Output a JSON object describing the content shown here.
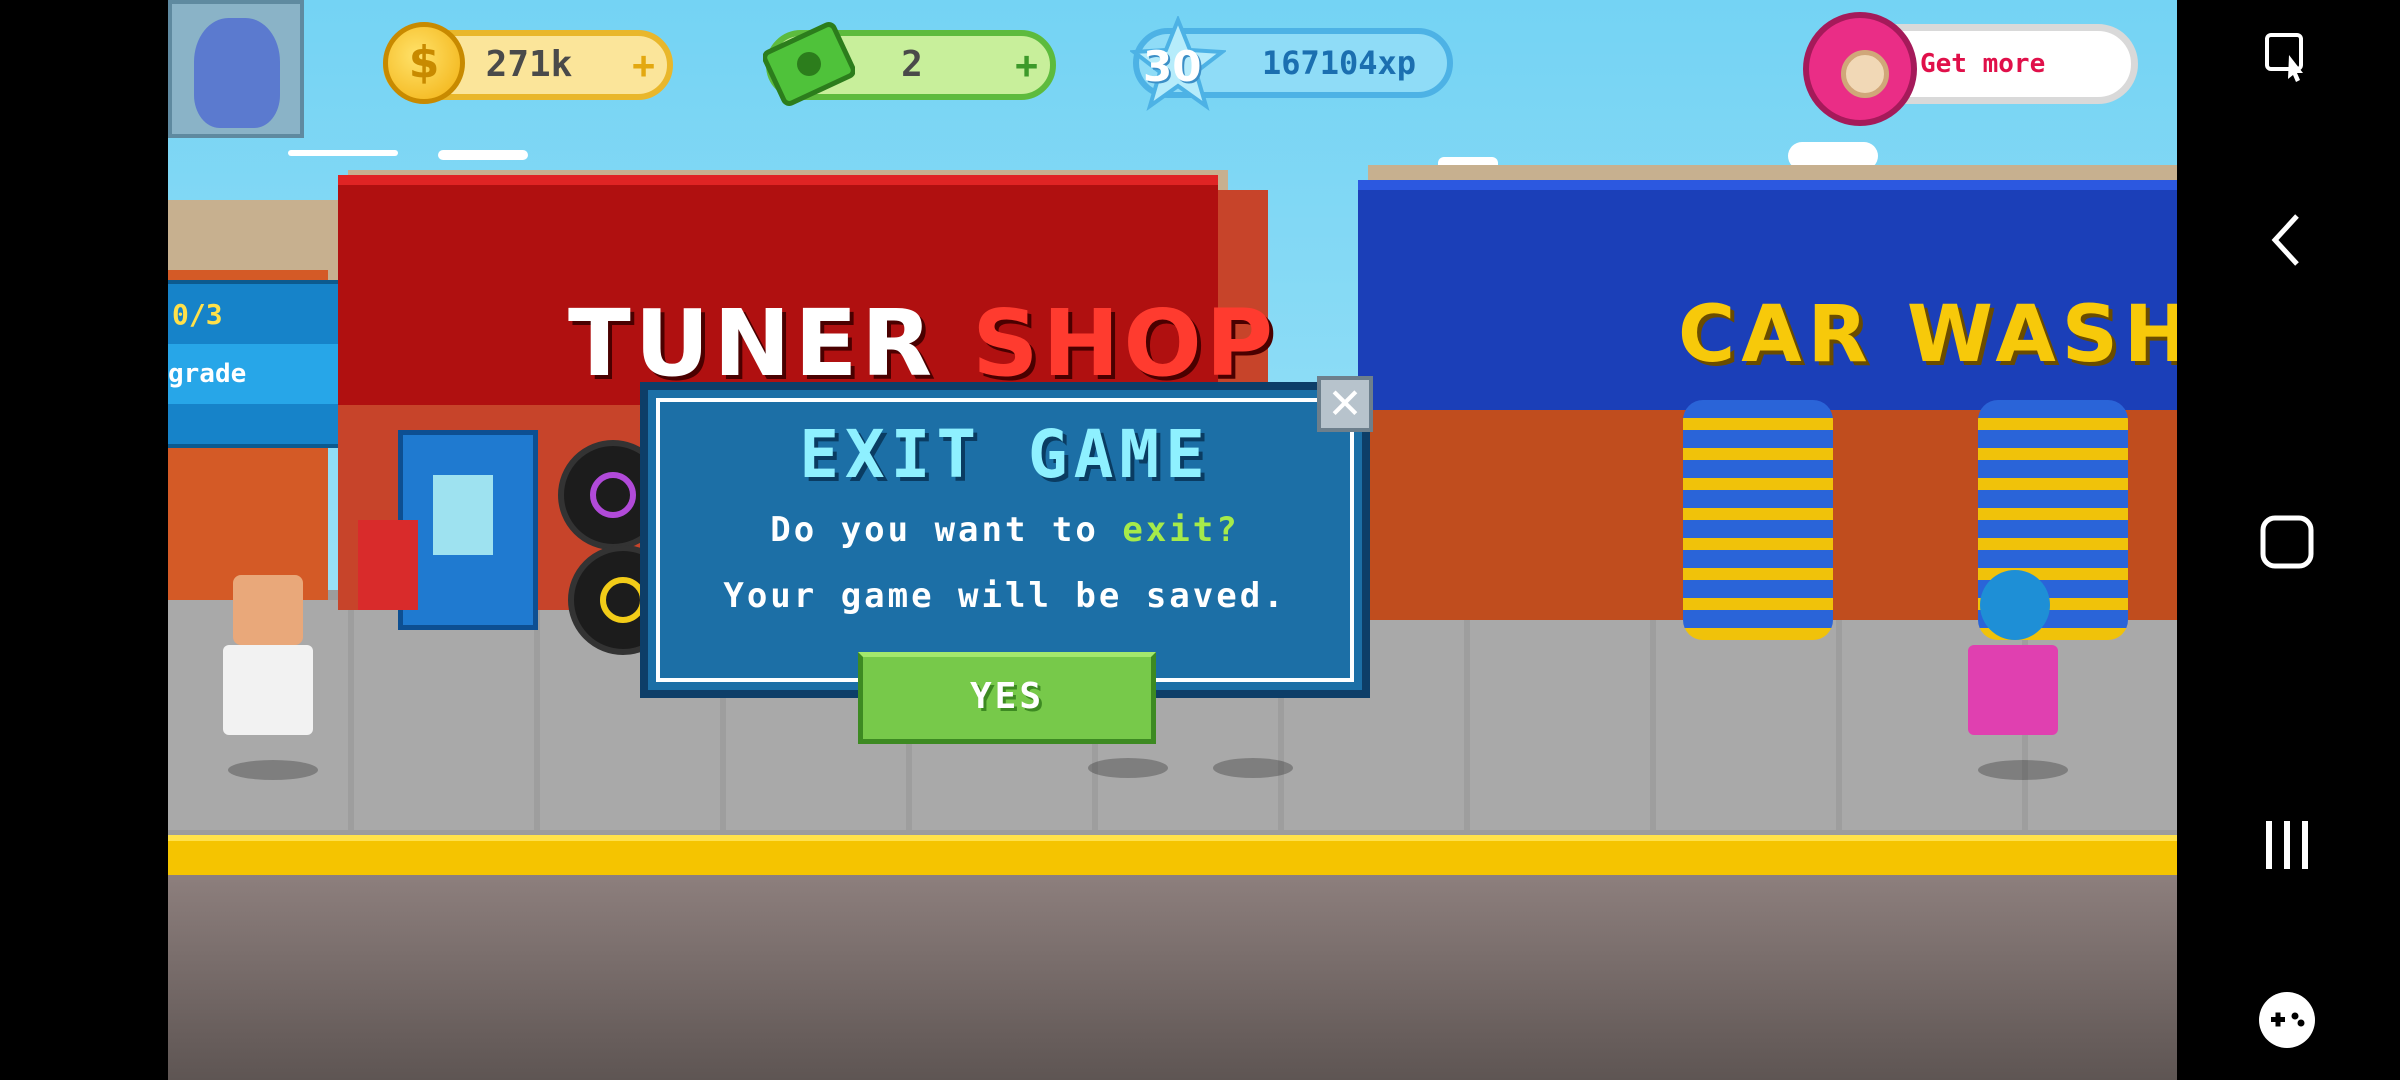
{
  "hud": {
    "coins": "271k",
    "cash": "2",
    "level": "30",
    "xp": "167104xp",
    "donut_label": "Get more",
    "plus_symbol": "+",
    "coin_symbol": "$"
  },
  "scene": {
    "tuner_shop_word1": "TUNER",
    "tuner_shop_word2": "SHOP",
    "car_wash": "CAR WASH",
    "upgrade_count": "0/3",
    "upgrade_label": "grade"
  },
  "dialog": {
    "title": "EXIT GAME",
    "line1_prefix": "Do you want to ",
    "line1_accent": "exit?",
    "line2": "Your game will be saved.",
    "yes_label": "YES",
    "close_symbol": "✕"
  },
  "navbar": {
    "icons": [
      "screenshot-edit-icon",
      "back-icon",
      "home-icon",
      "recents-icon",
      "game-tools-icon"
    ]
  },
  "colors": {
    "dialog_bg": "#1c6fa6",
    "title": "#8ef0ff",
    "accent": "#a6ea4a",
    "yes_button": "#77c94a"
  }
}
